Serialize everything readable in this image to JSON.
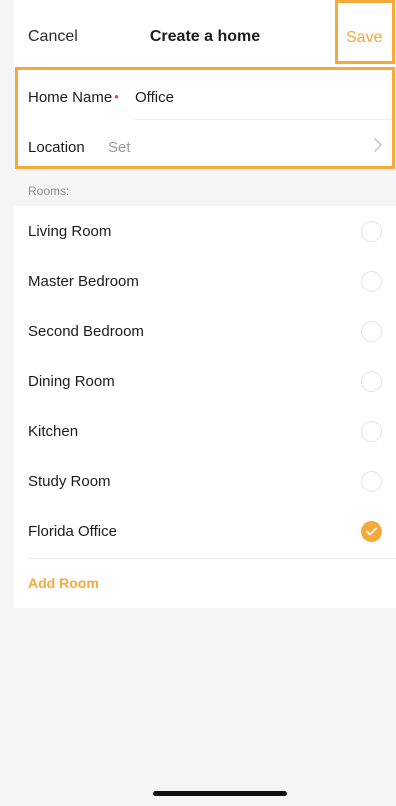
{
  "header": {
    "cancel_label": "Cancel",
    "title": "Create a home",
    "save_label": "Save"
  },
  "form": {
    "home_name_label": "Home Name",
    "required_mark": "•",
    "home_name_value": "Office",
    "location_label": "Location",
    "location_value": "Set"
  },
  "rooms": {
    "section_label": "Rooms:",
    "items": [
      {
        "label": "Living Room",
        "selected": false
      },
      {
        "label": "Master Bedroom",
        "selected": false
      },
      {
        "label": "Second Bedroom",
        "selected": false
      },
      {
        "label": "Dining Room",
        "selected": false
      },
      {
        "label": "Kitchen",
        "selected": false
      },
      {
        "label": "Study Room",
        "selected": false
      },
      {
        "label": "Florida Office",
        "selected": true
      }
    ],
    "add_room_label": "Add Room"
  },
  "colors": {
    "accent": "#f5a93a",
    "required": "#e64a4a",
    "background": "#f5f5f7"
  },
  "icons": {
    "location_chevron": "chevron-right-icon",
    "selected_check": "checkmark-icon"
  }
}
